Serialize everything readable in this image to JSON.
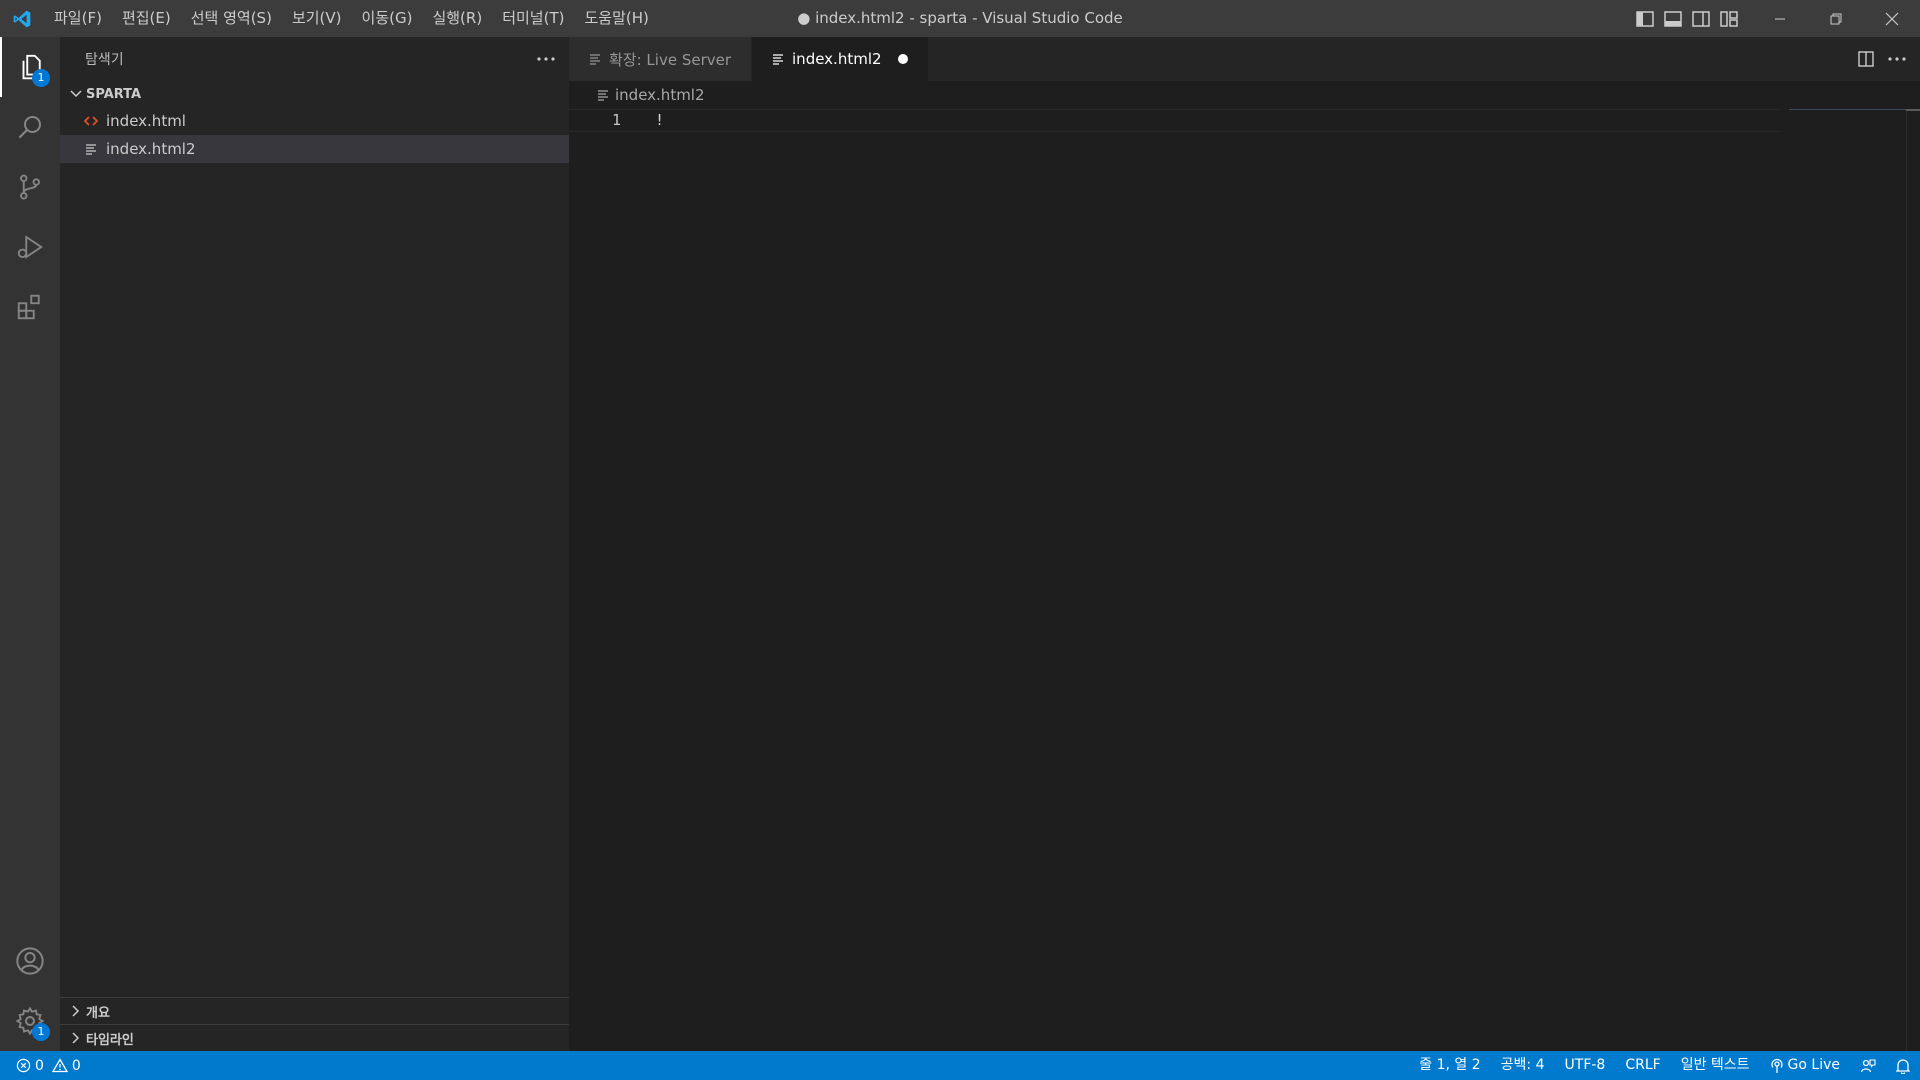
{
  "titlebar": {
    "window_title": "● index.html2 - sparta - Visual Studio Code",
    "menu": [
      "파일(F)",
      "편집(E)",
      "선택 영역(S)",
      "보기(V)",
      "이동(G)",
      "실행(R)",
      "터미널(T)",
      "도움말(H)"
    ]
  },
  "activitybar": {
    "explorer_badge": "1",
    "settings_badge": "1"
  },
  "sidebar": {
    "title": "탐색기",
    "folder": "SPARTA",
    "files": [
      "index.html",
      "index.html2"
    ],
    "sections": [
      "개요",
      "타임라인"
    ]
  },
  "editor": {
    "tabs": [
      "확장: Live Server",
      "index.html2"
    ],
    "breadcrumb": "index.html2",
    "line_number": "1",
    "line_text": "!"
  },
  "statusbar": {
    "errors": "0",
    "warnings": "0",
    "position": "줄 1, 열 2",
    "spaces": "공백: 4",
    "encoding": "UTF-8",
    "eol": "CRLF",
    "language": "일반 텍스트",
    "go_live": "Go Live"
  },
  "colors": {
    "accent": "#007acc",
    "vscode_blue": "#23a9f2",
    "html_icon": "#e44d26"
  }
}
